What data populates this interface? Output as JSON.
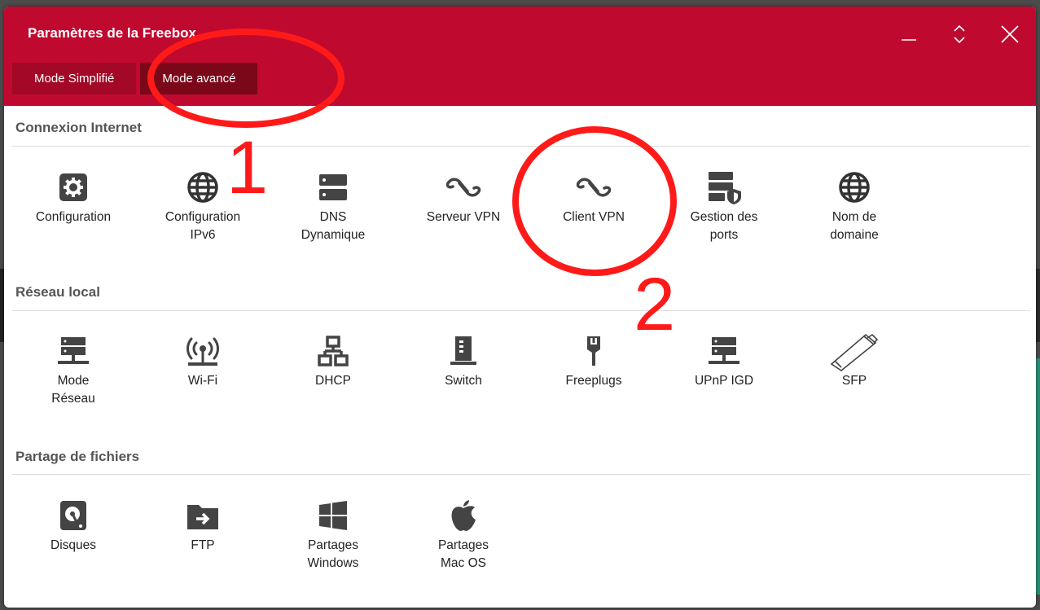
{
  "window": {
    "title": "Paramètres de la Freebox",
    "controls": {
      "minimize": "minimize",
      "maximize": "maximize",
      "close": "close"
    }
  },
  "tabs": [
    {
      "label": "Mode Simplifié",
      "active": false
    },
    {
      "label": "Mode avancé",
      "active": true
    }
  ],
  "sections": [
    {
      "title": "Connexion Internet",
      "items": [
        {
          "label": "Configuration",
          "icon": "gear-icon"
        },
        {
          "label": "Configuration\nIPv6",
          "icon": "globe-icon"
        },
        {
          "label": "DNS\nDynamique",
          "icon": "server-icon"
        },
        {
          "label": "Serveur VPN",
          "icon": "vpn-icon"
        },
        {
          "label": "Client VPN",
          "icon": "vpn-icon"
        },
        {
          "label": "Gestion des\nports",
          "icon": "server-shield-icon"
        },
        {
          "label": "Nom de\ndomaine",
          "icon": "globe-icon"
        }
      ]
    },
    {
      "title": "Réseau local",
      "items": [
        {
          "label": "Mode\nRéseau",
          "icon": "network-icon"
        },
        {
          "label": "Wi-Fi",
          "icon": "wifi-icon"
        },
        {
          "label": "DHCP",
          "icon": "dhcp-icon"
        },
        {
          "label": "Switch",
          "icon": "switch-icon"
        },
        {
          "label": "Freeplugs",
          "icon": "plug-icon"
        },
        {
          "label": "UPnP IGD",
          "icon": "network-icon"
        },
        {
          "label": "SFP",
          "icon": "sfp-icon"
        }
      ]
    },
    {
      "title": "Partage de fichiers",
      "items": [
        {
          "label": "Disques",
          "icon": "disk-icon"
        },
        {
          "label": "FTP",
          "icon": "ftp-icon"
        },
        {
          "label": "Partages\nWindows",
          "icon": "windows-icon"
        },
        {
          "label": "Partages\nMac OS",
          "icon": "apple-icon"
        }
      ]
    }
  ],
  "annotations": {
    "first": "1",
    "second": "2",
    "color": "#ff1a1a"
  },
  "colors": {
    "accent": "#c0092f",
    "tab_active": "#7a0819"
  }
}
